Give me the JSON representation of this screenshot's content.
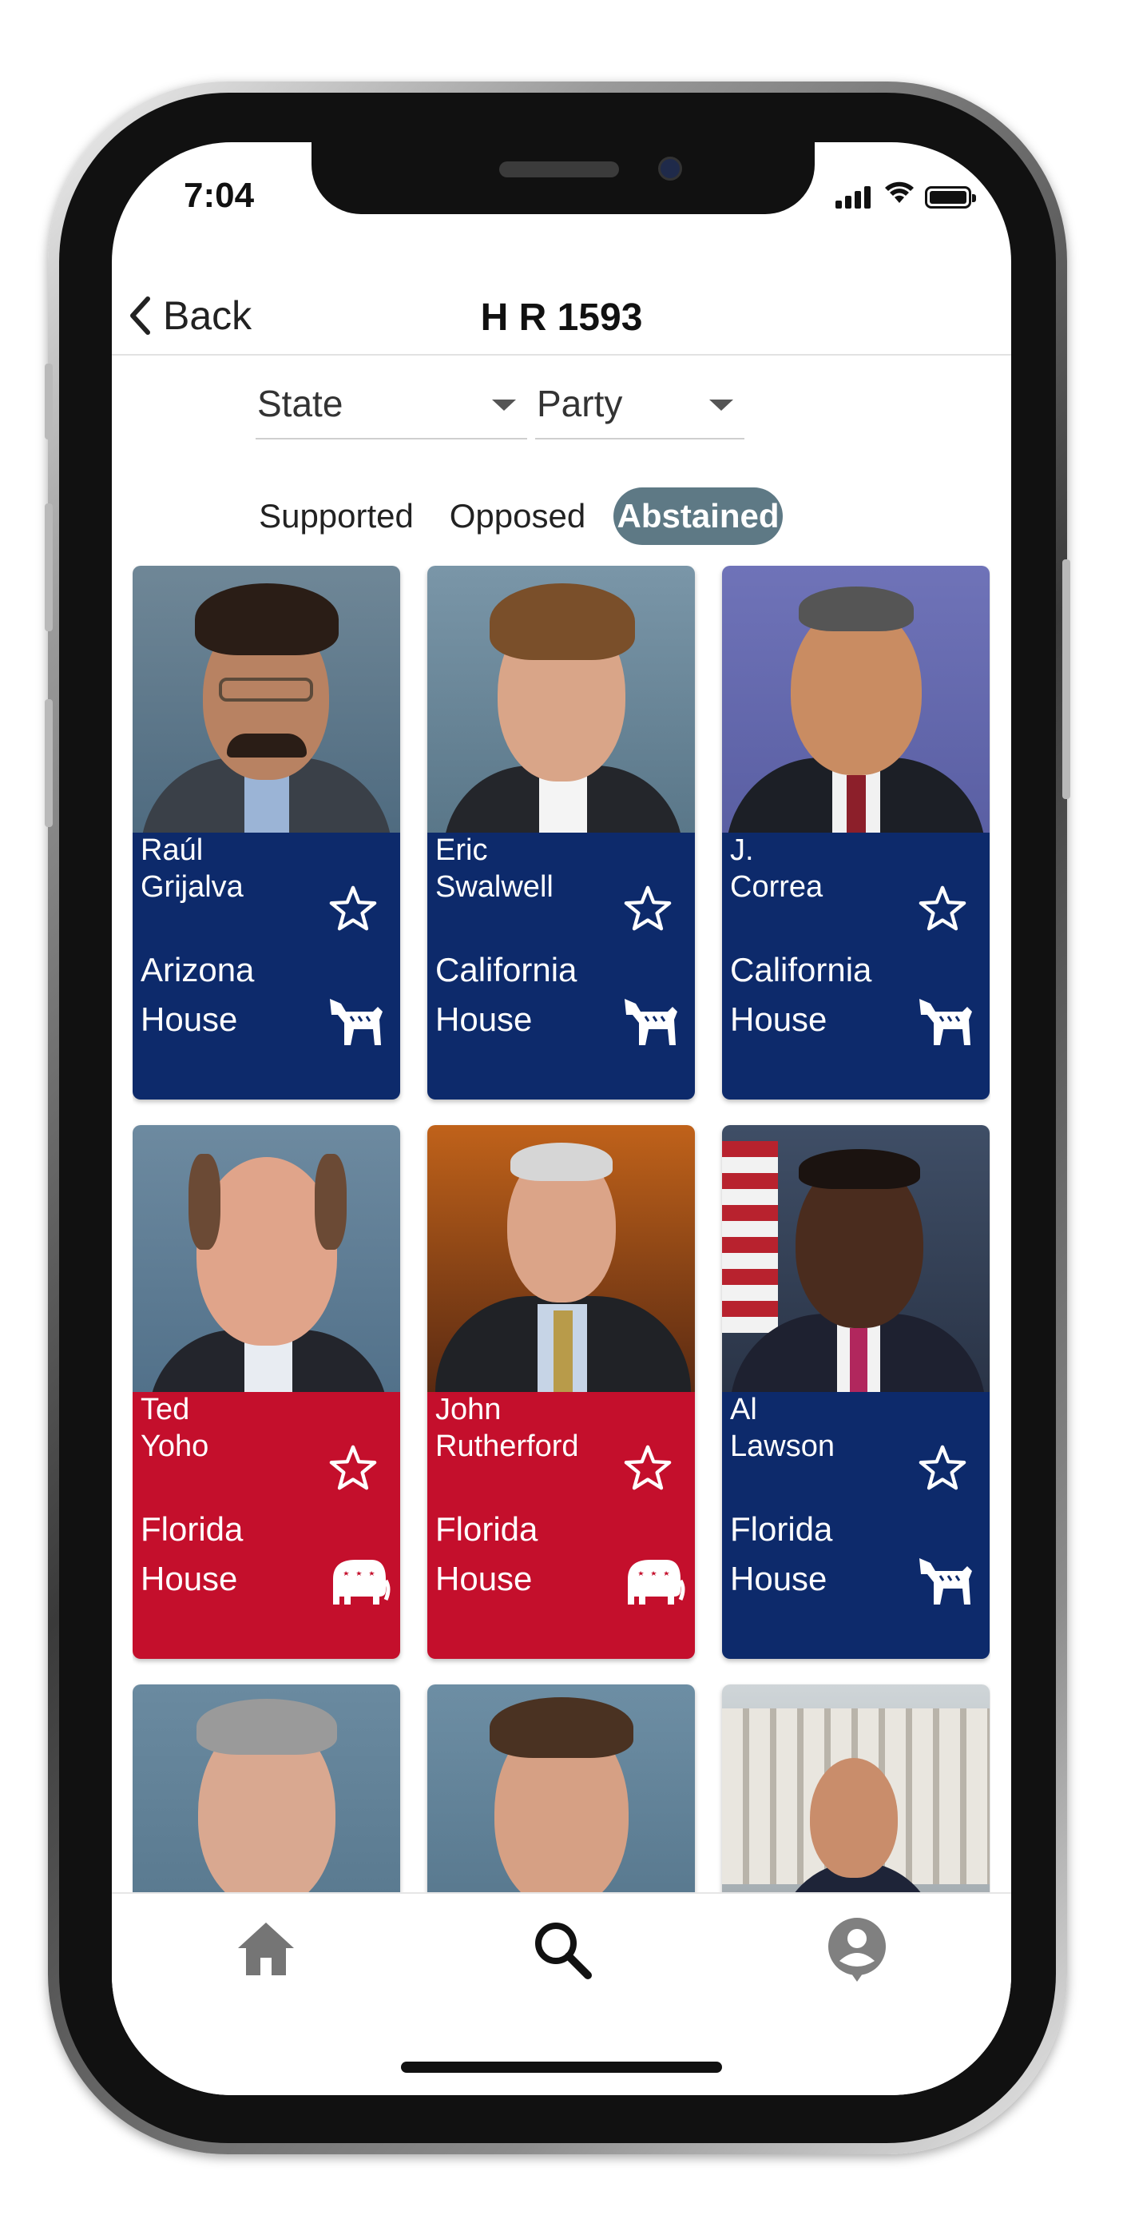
{
  "status_bar": {
    "time": "7:04"
  },
  "nav": {
    "back_label": "Back",
    "title": "H R 1593"
  },
  "filters": {
    "state_label": "State",
    "party_label": "Party"
  },
  "tabs": [
    {
      "label": "Supported",
      "active": false
    },
    {
      "label": "Opposed",
      "active": false
    },
    {
      "label": "Abstained",
      "active": true
    }
  ],
  "members": [
    {
      "first": "Raúl",
      "last": "Grijalva",
      "state": "Arizona",
      "chamber": "House",
      "party": "democrat",
      "party_icon": "donkey-icon",
      "favorite_icon": "star-outline-icon"
    },
    {
      "first": "Eric",
      "last": "Swalwell",
      "state": "California",
      "chamber": "House",
      "party": "democrat",
      "party_icon": "donkey-icon",
      "favorite_icon": "star-outline-icon"
    },
    {
      "first": "J.",
      "last": "Correa",
      "state": "California",
      "chamber": "House",
      "party": "democrat",
      "party_icon": "donkey-icon",
      "favorite_icon": "star-outline-icon"
    },
    {
      "first": "Ted",
      "last": "Yoho",
      "state": "Florida",
      "chamber": "House",
      "party": "republican",
      "party_icon": "elephant-icon",
      "favorite_icon": "star-outline-icon"
    },
    {
      "first": "John",
      "last": "Rutherford",
      "state": "Florida",
      "chamber": "House",
      "party": "republican",
      "party_icon": "elephant-icon",
      "favorite_icon": "star-outline-icon"
    },
    {
      "first": "Al",
      "last": "Lawson",
      "state": "Florida",
      "chamber": "House",
      "party": "democrat",
      "party_icon": "donkey-icon",
      "favorite_icon": "star-outline-icon"
    }
  ],
  "colors": {
    "democrat": "#0d2a6b",
    "republican": "#c40f2c",
    "tab_active": "#5e7985"
  },
  "tab_bar": {
    "items": [
      "home-icon",
      "search-icon",
      "profile-icon"
    ],
    "active": "search-icon"
  }
}
